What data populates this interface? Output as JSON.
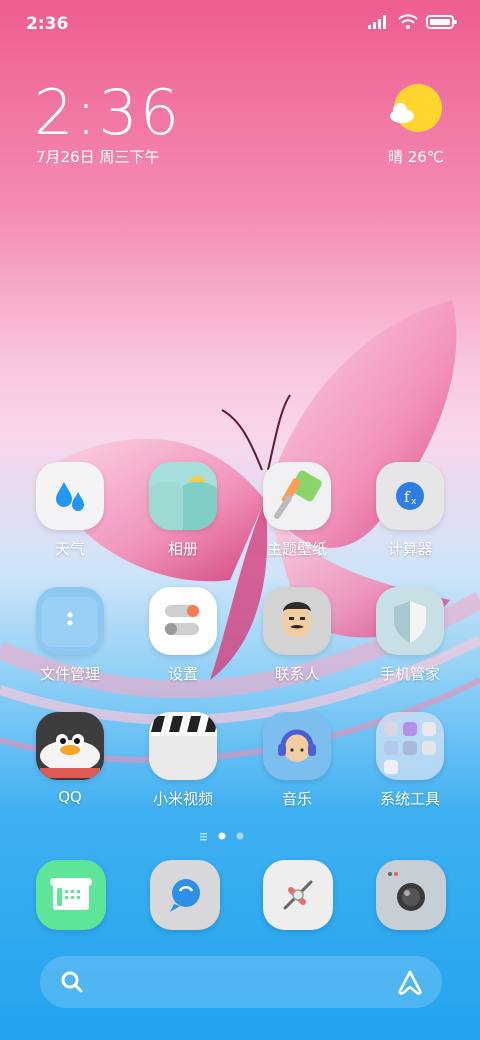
{
  "status_bar": {
    "time": "2:36"
  },
  "lock_widget": {
    "clock": "2:36",
    "date": "7月26日 周三下午",
    "weather": "晴 26℃"
  },
  "apps": [
    {
      "label": "天气",
      "icon": "weather-drops-icon"
    },
    {
      "label": "相册",
      "icon": "gallery-icon"
    },
    {
      "label": "主题壁纸",
      "icon": "theme-roller-icon"
    },
    {
      "label": "计算器",
      "icon": "calculator-icon"
    },
    {
      "label": "文件管理",
      "icon": "file-manager-icon"
    },
    {
      "label": "设置",
      "icon": "settings-toggle-icon"
    },
    {
      "label": "联系人",
      "icon": "contacts-face-icon"
    },
    {
      "label": "手机管家",
      "icon": "security-shield-icon"
    },
    {
      "label": "QQ",
      "icon": "qq-penguin-icon"
    },
    {
      "label": "小米视频",
      "icon": "video-clapper-icon"
    },
    {
      "label": "音乐",
      "icon": "music-headphone-icon"
    },
    {
      "label": "系统工具",
      "icon": "system-tools-folder-icon"
    }
  ],
  "dock": [
    "phone-icon",
    "messages-icon",
    "browser-icon",
    "camera-icon"
  ],
  "page_indicator": {
    "pages": 2,
    "current": 1
  },
  "colors": {
    "accent_pink": "#ee5d8f",
    "accent_blue": "#22a3ee"
  }
}
